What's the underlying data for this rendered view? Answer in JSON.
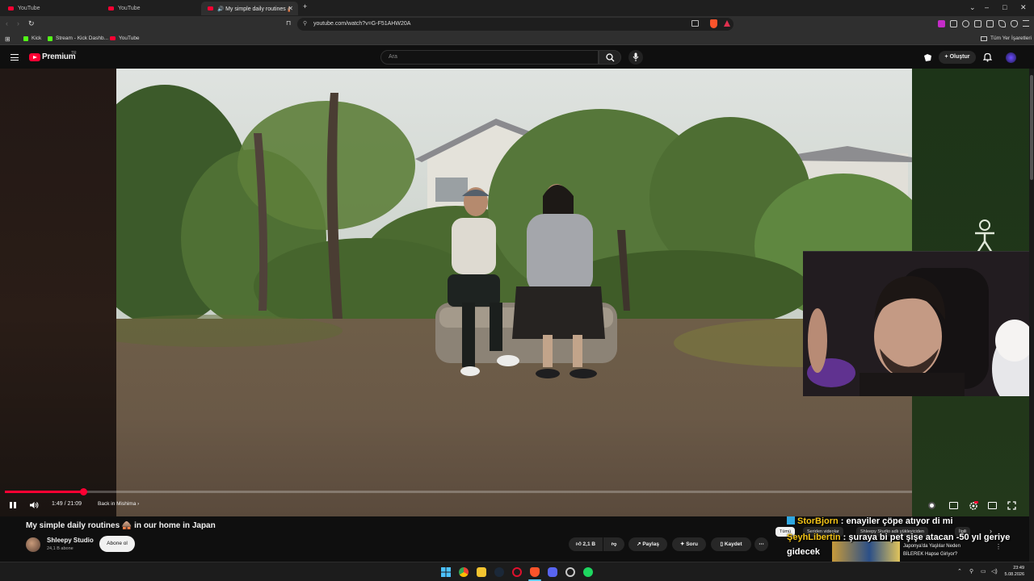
{
  "browser": {
    "tabs": [
      {
        "label": "YouTube"
      },
      {
        "label": "YouTube"
      },
      {
        "label": "My simple daily routines 🛖 in our home in Japan"
      }
    ],
    "new_tab_symbol": "+",
    "window_controls": [
      "⌄",
      "–",
      "□",
      "✕"
    ],
    "url": "youtube.com/watch?v=G-F51AHW20A",
    "bookmarks": [
      {
        "label": "Kick"
      },
      {
        "label": "Stream - Kick Dashb..."
      },
      {
        "label": "YouTube"
      }
    ],
    "all_bookmarks_label": "Tüm Yer İşaretleri"
  },
  "youtube": {
    "brand": "Premium",
    "region": "TR",
    "search_placeholder": "Ara",
    "create_label": "Oluştur"
  },
  "player": {
    "progress": 0.0868,
    "time_current": "1:49",
    "time_total": "21:09",
    "time_display": "1:49 / 21:09",
    "chapter": "Back in Mishima",
    "chapter_chevron": "›"
  },
  "video_info": {
    "title": "My simple daily routines 🛖 in our home in Japan",
    "channel": "Shleepy Studio",
    "subscribers": "24,1 B abone",
    "subscribe_label": "Abone ol",
    "likes": "2,1 B",
    "share_label": "Paylaş",
    "ask_label": "Soru",
    "save_label": "Kaydet",
    "more_label": "⋯"
  },
  "recommend_chips": [
    "Tümü",
    "Seriden videolar",
    "Shleepy Studio adlı yükleyiciden",
    "İlgili"
  ],
  "chip_chevron": "›",
  "recommendation": {
    "title_line1": "Japonya'da Yaşlılar Neden",
    "title_line2": "BİLEREK Hapse Giriyor?",
    "more_label": "⋮"
  },
  "chat": [
    {
      "user": "StorBjorn",
      "sep": " : ",
      "message": "enayiler çöpe atıyor di mi"
    },
    {
      "user": "ŞeyhLibertin",
      "sep": " : ",
      "message": "şuraya bi pet şişe atacan -50 yıl geriye",
      "message_cont": "gidecek"
    }
  ],
  "taskbar": {
    "time": "23:49",
    "date": "5.08.2026"
  },
  "colors": {
    "accent_red": "#ff0033",
    "kick_green": "#53fc18",
    "chat_user": "#f5c518"
  }
}
